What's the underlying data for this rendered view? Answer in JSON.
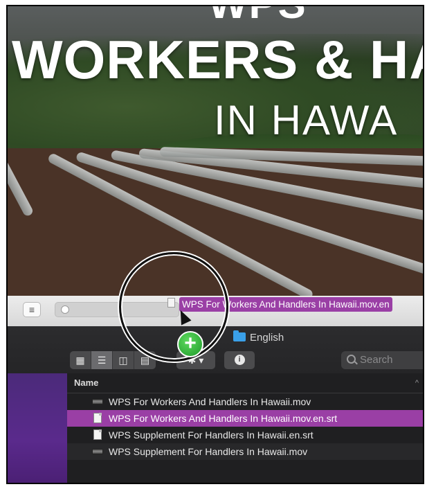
{
  "video": {
    "title_top": "WPS",
    "title_main": "WORKERS & HA",
    "title_sub": "IN HAWA"
  },
  "player": {
    "list_button": "≡",
    "dragging_file": "WPS For Workers And Handlers In Hawaii.mov.en"
  },
  "drag": {
    "badge": "+"
  },
  "finder": {
    "folder": "English",
    "view_buttons": [
      "▦",
      "☰",
      "◫",
      "▤"
    ],
    "gear": "✱ ▾",
    "info": "i",
    "search_placeholder": "Search",
    "column_name": "Name",
    "sort_indicator": "^",
    "files": [
      {
        "name": "WPS For Workers And Handlers In Hawaii.mov",
        "kind": "movie"
      },
      {
        "name": "WPS For Workers And Handlers In Hawaii.mov.en.srt",
        "kind": "document",
        "selected": true
      },
      {
        "name": "WPS Supplement For Handlers In Hawaii.en.srt",
        "kind": "document"
      },
      {
        "name": "WPS Supplement For Handlers In Hawaii.mov",
        "kind": "movie"
      }
    ]
  },
  "colors": {
    "selection": "#9a3fa5",
    "sidebar": "#5a2a8c",
    "folder": "#3aa0e8",
    "badge": "#2fb83a"
  }
}
